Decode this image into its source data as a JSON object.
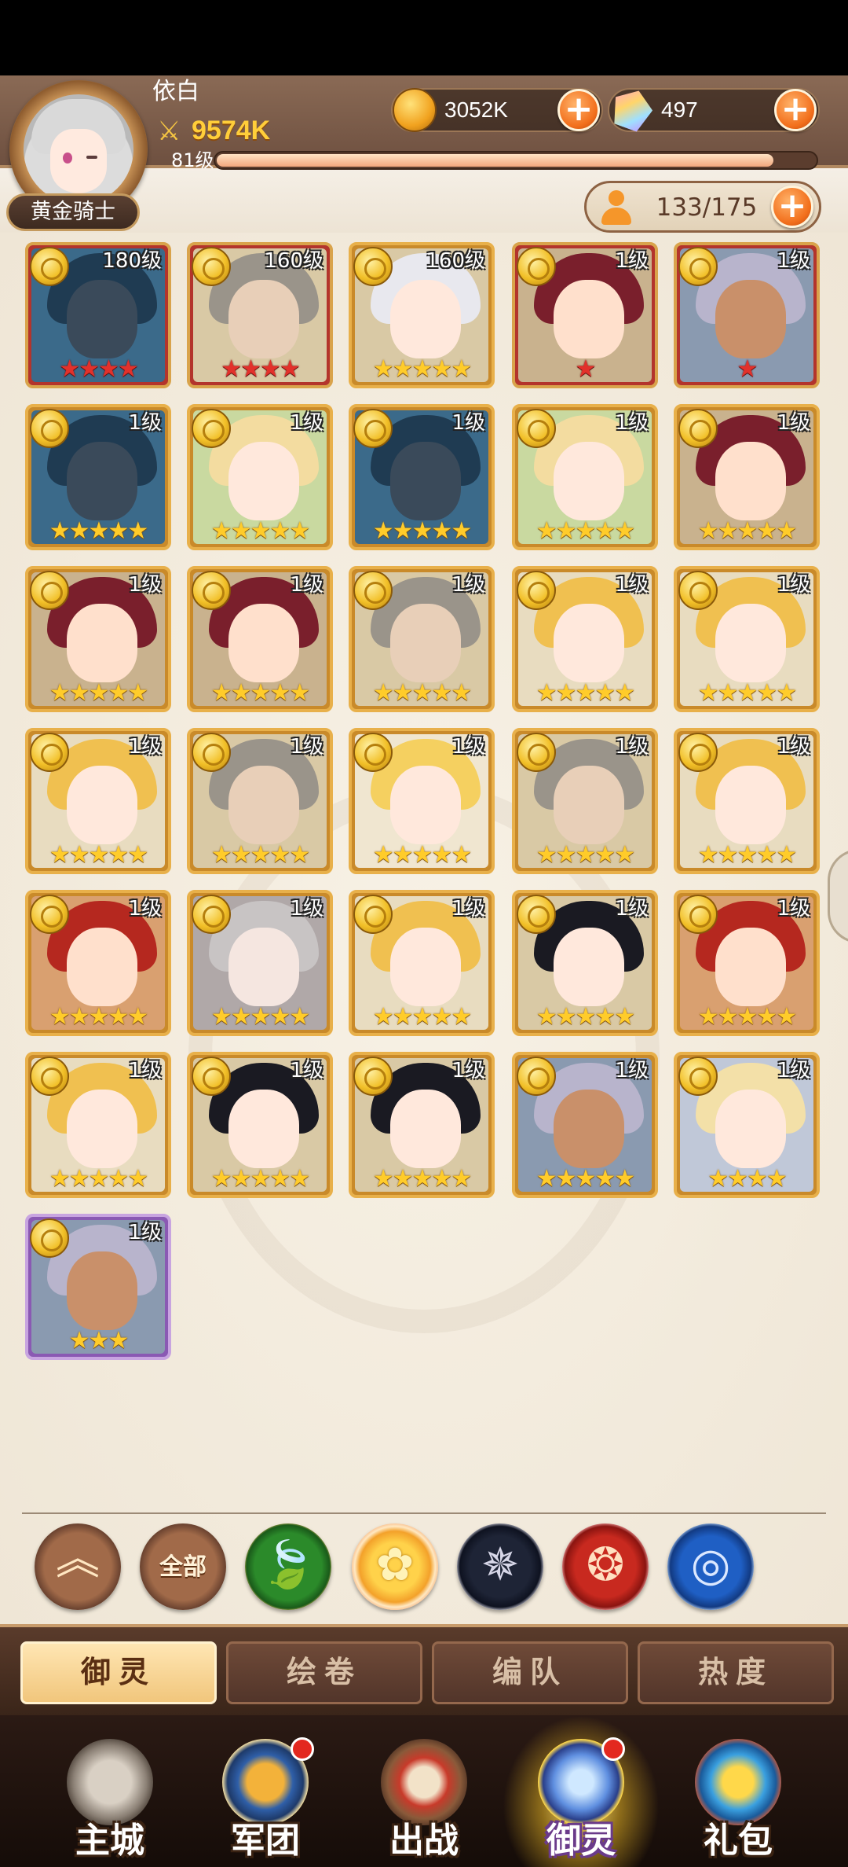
{
  "player": {
    "name": "依白",
    "title": "黄金骑士",
    "power": "9574K",
    "level_label": "81级",
    "xp_fraction": 0.93
  },
  "resources": {
    "gold": "3052K",
    "gems": "497",
    "capacity": "133/175"
  },
  "colors": {
    "accent_orange": "#f26f1c",
    "card_red": "#b3342c",
    "card_gold": "#c98a2a",
    "card_purple": "#8a59b3",
    "star_gold": "#ffcc2a",
    "star_red": "#e2312b"
  },
  "heroes": [
    {
      "level": "180级",
      "frame": "red",
      "stars": "★★★★",
      "star_color": "red",
      "hair": "#1f3b52",
      "skin": "#3a4a5a",
      "bg": "#3b6a8a"
    },
    {
      "level": "160级",
      "frame": "red",
      "stars": "★★★★",
      "star_color": "red",
      "hair": "#9a948a",
      "skin": "#e8cfb8",
      "bg": "#d9c9a5"
    },
    {
      "level": "160级",
      "frame": "gold",
      "stars": "★★★★★",
      "star_color": "gold",
      "hair": "#e8e8ee",
      "skin": "#ffe8dc",
      "bg": "#d9c9a5"
    },
    {
      "level": "1级",
      "frame": "red",
      "stars": "★",
      "star_color": "red",
      "hair": "#7a1f2c",
      "skin": "#ffe0cc",
      "bg": "#c9b28e"
    },
    {
      "level": "1级",
      "frame": "red",
      "stars": "★",
      "star_color": "red",
      "hair": "#b8b4cc",
      "skin": "#c9906a",
      "bg": "#8a9ab0"
    },
    {
      "level": "1级",
      "frame": "gold",
      "stars": "★★★★★",
      "star_color": "gold",
      "hair": "#1f3b52",
      "skin": "#3a4a5a",
      "bg": "#3b6a8a"
    },
    {
      "level": "1级",
      "frame": "gold",
      "stars": "★★★★★",
      "star_color": "gold",
      "hair": "#f3dca0",
      "skin": "#ffe8dc",
      "bg": "#c9d9a0"
    },
    {
      "level": "1级",
      "frame": "gold",
      "stars": "★★★★★",
      "star_color": "gold",
      "hair": "#1f3b52",
      "skin": "#3a4a5a",
      "bg": "#3b6a8a"
    },
    {
      "level": "1级",
      "frame": "gold",
      "stars": "★★★★★",
      "star_color": "gold",
      "hair": "#f3dca0",
      "skin": "#ffe8dc",
      "bg": "#c9d9a0"
    },
    {
      "level": "1级",
      "frame": "gold",
      "stars": "★★★★★",
      "star_color": "gold",
      "hair": "#7a1f2c",
      "skin": "#ffe0cc",
      "bg": "#c9b28e"
    },
    {
      "level": "1级",
      "frame": "gold",
      "stars": "★★★★★",
      "star_color": "gold",
      "hair": "#7a1f2c",
      "skin": "#ffe0cc",
      "bg": "#c9b28e"
    },
    {
      "level": "1级",
      "frame": "gold",
      "stars": "★★★★★",
      "star_color": "gold",
      "hair": "#7a1f2c",
      "skin": "#ffe0cc",
      "bg": "#c9b28e"
    },
    {
      "level": "1级",
      "frame": "gold",
      "stars": "★★★★★",
      "star_color": "gold",
      "hair": "#9a948a",
      "skin": "#e8cfb8",
      "bg": "#d9c9a5"
    },
    {
      "level": "1级",
      "frame": "gold",
      "stars": "★★★★★",
      "star_color": "gold",
      "hair": "#f0c050",
      "skin": "#ffe8dc",
      "bg": "#e8dcc0"
    },
    {
      "level": "1级",
      "frame": "gold",
      "stars": "★★★★★",
      "star_color": "gold",
      "hair": "#f0c050",
      "skin": "#ffe8dc",
      "bg": "#e8dcc0"
    },
    {
      "level": "1级",
      "frame": "gold",
      "stars": "★★★★★",
      "star_color": "gold",
      "hair": "#f0c050",
      "skin": "#ffe8dc",
      "bg": "#e8dcc0"
    },
    {
      "level": "1级",
      "frame": "gold",
      "stars": "★★★★★",
      "star_color": "gold",
      "hair": "#9a948a",
      "skin": "#e8cfb8",
      "bg": "#d9c9a5"
    },
    {
      "level": "1级",
      "frame": "gold",
      "stars": "★★★★★",
      "star_color": "gold",
      "hair": "#f5d060",
      "skin": "#ffe8dc",
      "bg": "#f0e6d0"
    },
    {
      "level": "1级",
      "frame": "gold",
      "stars": "★★★★★",
      "star_color": "gold",
      "hair": "#9a948a",
      "skin": "#e8cfb8",
      "bg": "#d9c9a5"
    },
    {
      "level": "1级",
      "frame": "gold",
      "stars": "★★★★★",
      "star_color": "gold",
      "hair": "#f0c050",
      "skin": "#ffe8dc",
      "bg": "#e8dcc0"
    },
    {
      "level": "1级",
      "frame": "gold",
      "stars": "★★★★★",
      "star_color": "gold",
      "hair": "#b5281f",
      "skin": "#ffe0cc",
      "bg": "#d9a070"
    },
    {
      "level": "1级",
      "frame": "gold",
      "stars": "★★★★★",
      "star_color": "gold",
      "hair": "#c8c4c4",
      "skin": "#f5e6e0",
      "bg": "#b0a8a8"
    },
    {
      "level": "1级",
      "frame": "gold",
      "stars": "★★★★★",
      "star_color": "gold",
      "hair": "#f0c050",
      "skin": "#ffe8dc",
      "bg": "#e8dcc0"
    },
    {
      "level": "1级",
      "frame": "gold",
      "stars": "★★★★★",
      "star_color": "gold",
      "hair": "#1a1a22",
      "skin": "#ffe8dc",
      "bg": "#d9c9a5"
    },
    {
      "level": "1级",
      "frame": "gold",
      "stars": "★★★★★",
      "star_color": "gold",
      "hair": "#b5281f",
      "skin": "#ffe0cc",
      "bg": "#d9a070"
    },
    {
      "level": "1级",
      "frame": "gold",
      "stars": "★★★★★",
      "star_color": "gold",
      "hair": "#f0c050",
      "skin": "#ffe8dc",
      "bg": "#e8dcc0"
    },
    {
      "level": "1级",
      "frame": "gold",
      "stars": "★★★★★",
      "star_color": "gold",
      "hair": "#1a1a22",
      "skin": "#ffe8dc",
      "bg": "#d9c9a5"
    },
    {
      "level": "1级",
      "frame": "gold",
      "stars": "★★★★★",
      "star_color": "gold",
      "hair": "#1a1a22",
      "skin": "#ffe8dc",
      "bg": "#d9c9a5"
    },
    {
      "level": "1级",
      "frame": "gold",
      "stars": "★★★★★",
      "star_color": "gold",
      "hair": "#b8b4cc",
      "skin": "#c9906a",
      "bg": "#8a9ab0"
    },
    {
      "level": "1级",
      "frame": "gold",
      "stars": "★★★★",
      "star_color": "gold",
      "hair": "#f3e0a8",
      "skin": "#ffe8dc",
      "bg": "#c0c8d8"
    },
    {
      "level": "1级",
      "frame": "purple",
      "stars": "★★★",
      "star_color": "gold",
      "hair": "#b8b4cc",
      "skin": "#c9906a",
      "bg": "#8a9ab0"
    }
  ],
  "filters": {
    "all_label": "全部",
    "icons": [
      "collapse-icon",
      "all-filter",
      "nature-element-icon",
      "light-element-icon",
      "dark-element-icon",
      "fire-element-icon",
      "water-element-icon"
    ]
  },
  "subtabs": [
    "御灵",
    "绘卷",
    "编队",
    "热度"
  ],
  "nav": [
    "主城",
    "军团",
    "出战",
    "御灵",
    "礼包"
  ]
}
